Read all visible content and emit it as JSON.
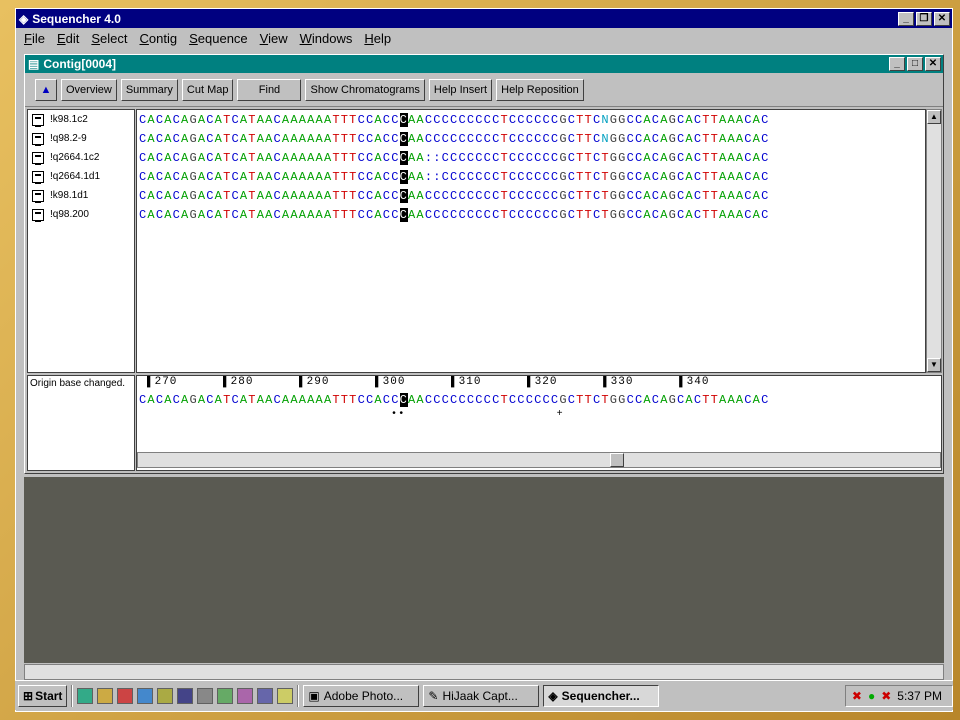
{
  "app": {
    "title": "Sequencher  4.0"
  },
  "menu": [
    "File",
    "Edit",
    "Select",
    "Contig",
    "Sequence",
    "View",
    "Windows",
    "Help"
  ],
  "child": {
    "title": "Contig[0004]"
  },
  "toolbar": [
    "Overview",
    "Summary",
    "Cut Map",
    "Find",
    "Show Chromatograms",
    "Help Insert",
    "Help Reposition"
  ],
  "fragments": [
    {
      "name": "!k98.1c2",
      "seq": "CACACAGACATCATAACAAAAAATTTCCACCCAACCCCCCCCCTCCCCCCGCTTCNGGCCACAGCACTTAAACAC"
    },
    {
      "name": "!q98.2-9",
      "seq": "CACACAGACATCATAACAAAAAATTTCCACCCAACCCCCCCCCTCCCCCCGCTTCNGGCCACAGCACTTAAACAC"
    },
    {
      "name": "!q2664.1c2",
      "seq": "CACACAGACATCATAACAAAAAATTTCCACCCAA::CCCCCCCTCCCCCCGCTTCTGGCCACAGCACTTAAACAC"
    },
    {
      "name": "!q2664.1d1",
      "seq": "CACACAGACATCATAACAAAAAATTTCCACCCAA::CCCCCCCTCCCCCCGCTTCTGGCCACAGCACTTAAACAC"
    },
    {
      "name": "!k98.1d1",
      "seq": "CACACAGACATCATAACAAAAAATTTCCACCCAACCCCCCCCCTCCCCCCGCTTCTGGCCACAGCACTTAAACAC"
    },
    {
      "name": "!q98.200",
      "seq": "CACACAGACATCATAACAAAAAATTTCCACCCAACCCCCCCCCTCCCCCCGCTTCTGGCCACAGCACTTAAACAC"
    }
  ],
  "consensus": {
    "label": "Origin base changed.",
    "ruler": [
      "270",
      "280",
      "290",
      "300",
      "310",
      "320",
      "330",
      "340"
    ],
    "seq": "CACACAGACATCATAACAAAAAATTTCCACCCAACCCCCCCCCTCCCCCCGCTTCTGGCCACAGCACTTAAACAC",
    "marks": "                                   ••                     +"
  },
  "taskbar": {
    "start": "Start",
    "tasks": [
      "Adobe Photo...",
      "HiJaak Capt...",
      "Sequencher..."
    ],
    "time": "5:37 PM"
  }
}
